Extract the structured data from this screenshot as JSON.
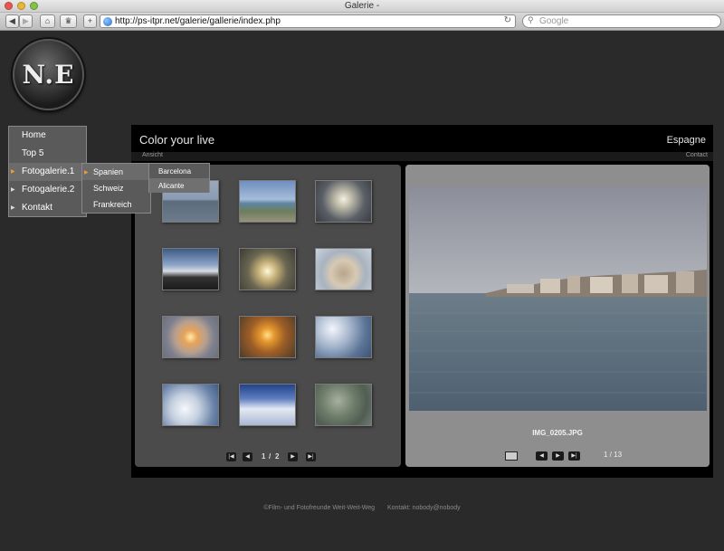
{
  "window": {
    "title": "Galerie -"
  },
  "browser": {
    "url": "http://ps-itpr.net/galerie/gallerie/index.php",
    "search_placeholder": "Google"
  },
  "logo": {
    "text": "N.E"
  },
  "header": {
    "title": "Color your live",
    "right": "Espagne"
  },
  "subbar": {
    "left": "Ansicht",
    "right": "Contact"
  },
  "menu": {
    "items": [
      {
        "label": "Home"
      },
      {
        "label": "Top 5"
      },
      {
        "label": "Fotogalerie.1"
      },
      {
        "label": "Fotogalerie.2"
      },
      {
        "label": "Kontakt"
      }
    ],
    "submenu": [
      {
        "label": "Spanien"
      },
      {
        "label": "Schweiz"
      },
      {
        "label": "Frankreich"
      }
    ],
    "submenu2": [
      {
        "label": "Barcelona"
      },
      {
        "label": "Alicante"
      }
    ]
  },
  "pager": {
    "current": "1",
    "separator": "/",
    "total": "2"
  },
  "viewer": {
    "filename": "IMG_0205.JPG",
    "counter": "1 / 13"
  },
  "footer": {
    "copyright": "©Film- und Fotofreunde Weit-Weit-Weg",
    "contact": "Kontakt: nobody@nobody"
  },
  "colors": {
    "accent": "#f29a3a",
    "panel": "#4b4b4b",
    "viewer_panel": "#8e8e8e"
  }
}
